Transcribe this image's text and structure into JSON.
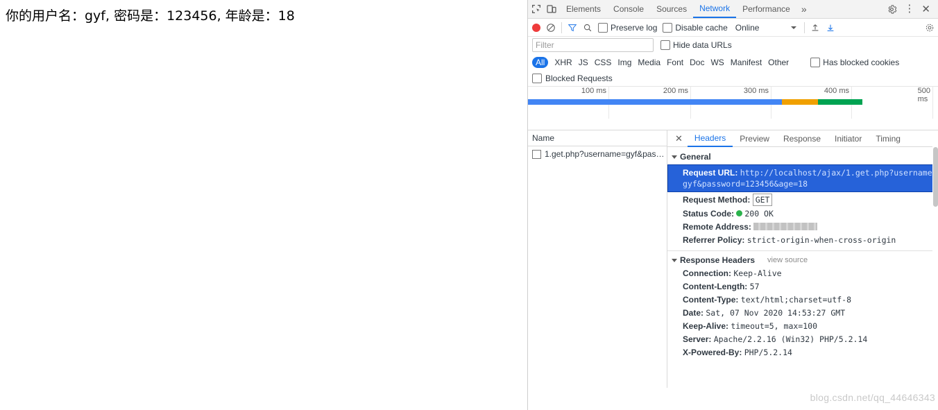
{
  "page": {
    "body_text": "你的用户名：gyf, 密码是：123456, 年龄是：18"
  },
  "devtools": {
    "tabs": [
      {
        "label": "Elements",
        "active": false
      },
      {
        "label": "Console",
        "active": false
      },
      {
        "label": "Sources",
        "active": false
      },
      {
        "label": "Network",
        "active": true
      },
      {
        "label": "Performance",
        "active": false
      }
    ],
    "more_label": "»",
    "icons": {
      "inspect": "inspect-element-icon",
      "device": "device-toolbar-icon",
      "settings": "gear-icon",
      "menu": "kebab-menu-icon",
      "close": "close-icon"
    },
    "toolbar": {
      "record_label": "record-button",
      "clear_label": "clear-button",
      "filter_label": "filter-icon",
      "search_label": "search-icon",
      "preserve_log": "Preserve log",
      "disable_cache": "Disable cache",
      "throttle_value": "Online",
      "import_label": "import-har-icon",
      "export_label": "export-har-icon",
      "settings_label": "network-settings-icon"
    },
    "filter": {
      "placeholder": "Filter",
      "hide_data_urls": "Hide data URLs",
      "types": [
        "All",
        "XHR",
        "JS",
        "CSS",
        "Img",
        "Media",
        "Font",
        "Doc",
        "WS",
        "Manifest",
        "Other"
      ],
      "active_type": "All",
      "has_blocked_cookies": "Has blocked cookies",
      "blocked_requests": "Blocked Requests"
    },
    "overview": {
      "ticks": [
        "100 ms",
        "200 ms",
        "300 ms",
        "400 ms",
        "500 ms"
      ],
      "bar_color_blue": "#4285f4",
      "bar_color_orange": "#f0a000",
      "bar_color_green": "#00a352"
    },
    "request_list": {
      "column_header": "Name",
      "rows": [
        {
          "name": "1.get.php?username=gyf&pas…"
        }
      ]
    },
    "detail": {
      "tabs": [
        {
          "label": "Headers",
          "active": true
        },
        {
          "label": "Preview",
          "active": false
        },
        {
          "label": "Response",
          "active": false
        },
        {
          "label": "Initiator",
          "active": false
        },
        {
          "label": "Timing",
          "active": false
        }
      ],
      "general": {
        "title": "General",
        "request_url_key": "Request URL:",
        "request_url_value": "http://localhost/ajax/1.get.php?username=gyf&password=123456&age=18",
        "request_method_key": "Request Method:",
        "request_method_value": "GET",
        "status_code_key": "Status Code:",
        "status_code_value": "200 OK",
        "remote_address_key": "Remote Address:",
        "remote_address_value": "",
        "referrer_policy_key": "Referrer Policy:",
        "referrer_policy_value": "strict-origin-when-cross-origin"
      },
      "response_headers": {
        "title": "Response Headers",
        "view_source": "view source",
        "items": [
          {
            "key": "Connection:",
            "value": "Keep-Alive"
          },
          {
            "key": "Content-Length:",
            "value": "57"
          },
          {
            "key": "Content-Type:",
            "value": "text/html;charset=utf-8"
          },
          {
            "key": "Date:",
            "value": "Sat, 07 Nov 2020 14:53:27 GMT"
          },
          {
            "key": "Keep-Alive:",
            "value": "timeout=5, max=100"
          },
          {
            "key": "Server:",
            "value": "Apache/2.2.16 (Win32) PHP/5.2.14"
          },
          {
            "key": "X-Powered-By:",
            "value": "PHP/5.2.14"
          }
        ]
      }
    }
  },
  "watermark": "blog.csdn.net/qq_44646343"
}
